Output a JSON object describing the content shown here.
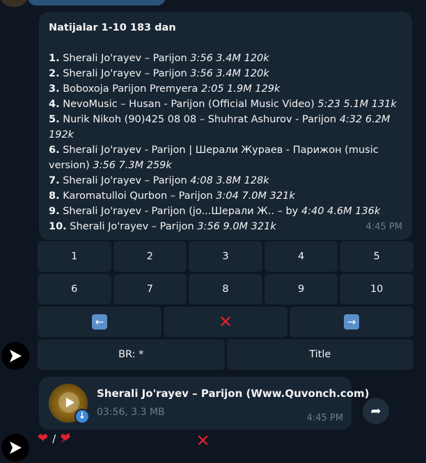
{
  "message": {
    "heading": "Natijalar 1-10 183 dan",
    "results": [
      {
        "num": "1.",
        "title": " Sherali Jo'rayev – Parijon ",
        "meta": "3:56 3.4M 120k"
      },
      {
        "num": "2.",
        "title": " Sherali Jo'rayev – Parijon ",
        "meta": "3:56 3.4M 120k"
      },
      {
        "num": "3.",
        "title": " Boboxoja Parijon Premyera ",
        "meta": "2:05 1.9M 129k"
      },
      {
        "num": "4.",
        "title": " NevoMusic – Husan - Parijon (Official Music Video) ",
        "meta": "5:23 5.1M 131k"
      },
      {
        "num": "5.",
        "title": " Nurik Nikoh (90)425 08 08 – Shuhrat Ashurov - Parijon ",
        "meta": "4:32 6.2M 192k"
      },
      {
        "num": "6.",
        "title": " Sherali Jo'rayev - Parijon | Шерали Жураев - Парижон (music version) ",
        "meta": "3:56 7.3M 259k"
      },
      {
        "num": "7.",
        "title": " Sherali Jo'rayev – Parijon ",
        "meta": "4:08 3.8M 128k"
      },
      {
        "num": "8.",
        "title": " Karomatulloi Qurbon – Parijon ",
        "meta": "3:04 7.0M 321k"
      },
      {
        "num": "9.",
        "title": " Sherali Jo'rayev - Parijon (jo...Шерали Ж.. – by ",
        "meta": "4:40 4.6M 136k"
      },
      {
        "num": "10.",
        "title": " Sherali Jo'rayev – Parijon ",
        "meta": "3:56 9.0M 321k"
      }
    ],
    "time": "4:45 PM"
  },
  "keyboard": {
    "row1": [
      "1",
      "2",
      "3",
      "4",
      "5"
    ],
    "row2": [
      "6",
      "7",
      "8",
      "9",
      "10"
    ],
    "prev_icon": "left-arrow-icon",
    "close_icon": "cross-mark-icon",
    "next_icon": "right-arrow-icon",
    "br_label": "BR: *",
    "title_label": "Title"
  },
  "audio": {
    "title": "Sherali Jo'rayev – Parijon (Www.Quvonch.com)",
    "meta": "03:56, 3.3 MB",
    "time": "4:45 PM"
  },
  "audio_keyboard": {
    "like_icon": "heart-icon",
    "separator": "/",
    "dislike_icon": "broken-heart-icon",
    "close_icon": "cross-mark-icon"
  },
  "colors": {
    "background": "#0e1621",
    "bubble": "#182533",
    "muted_text": "#6d7f8f",
    "accent": "#3d8ad9",
    "cross": "#e1222e"
  }
}
